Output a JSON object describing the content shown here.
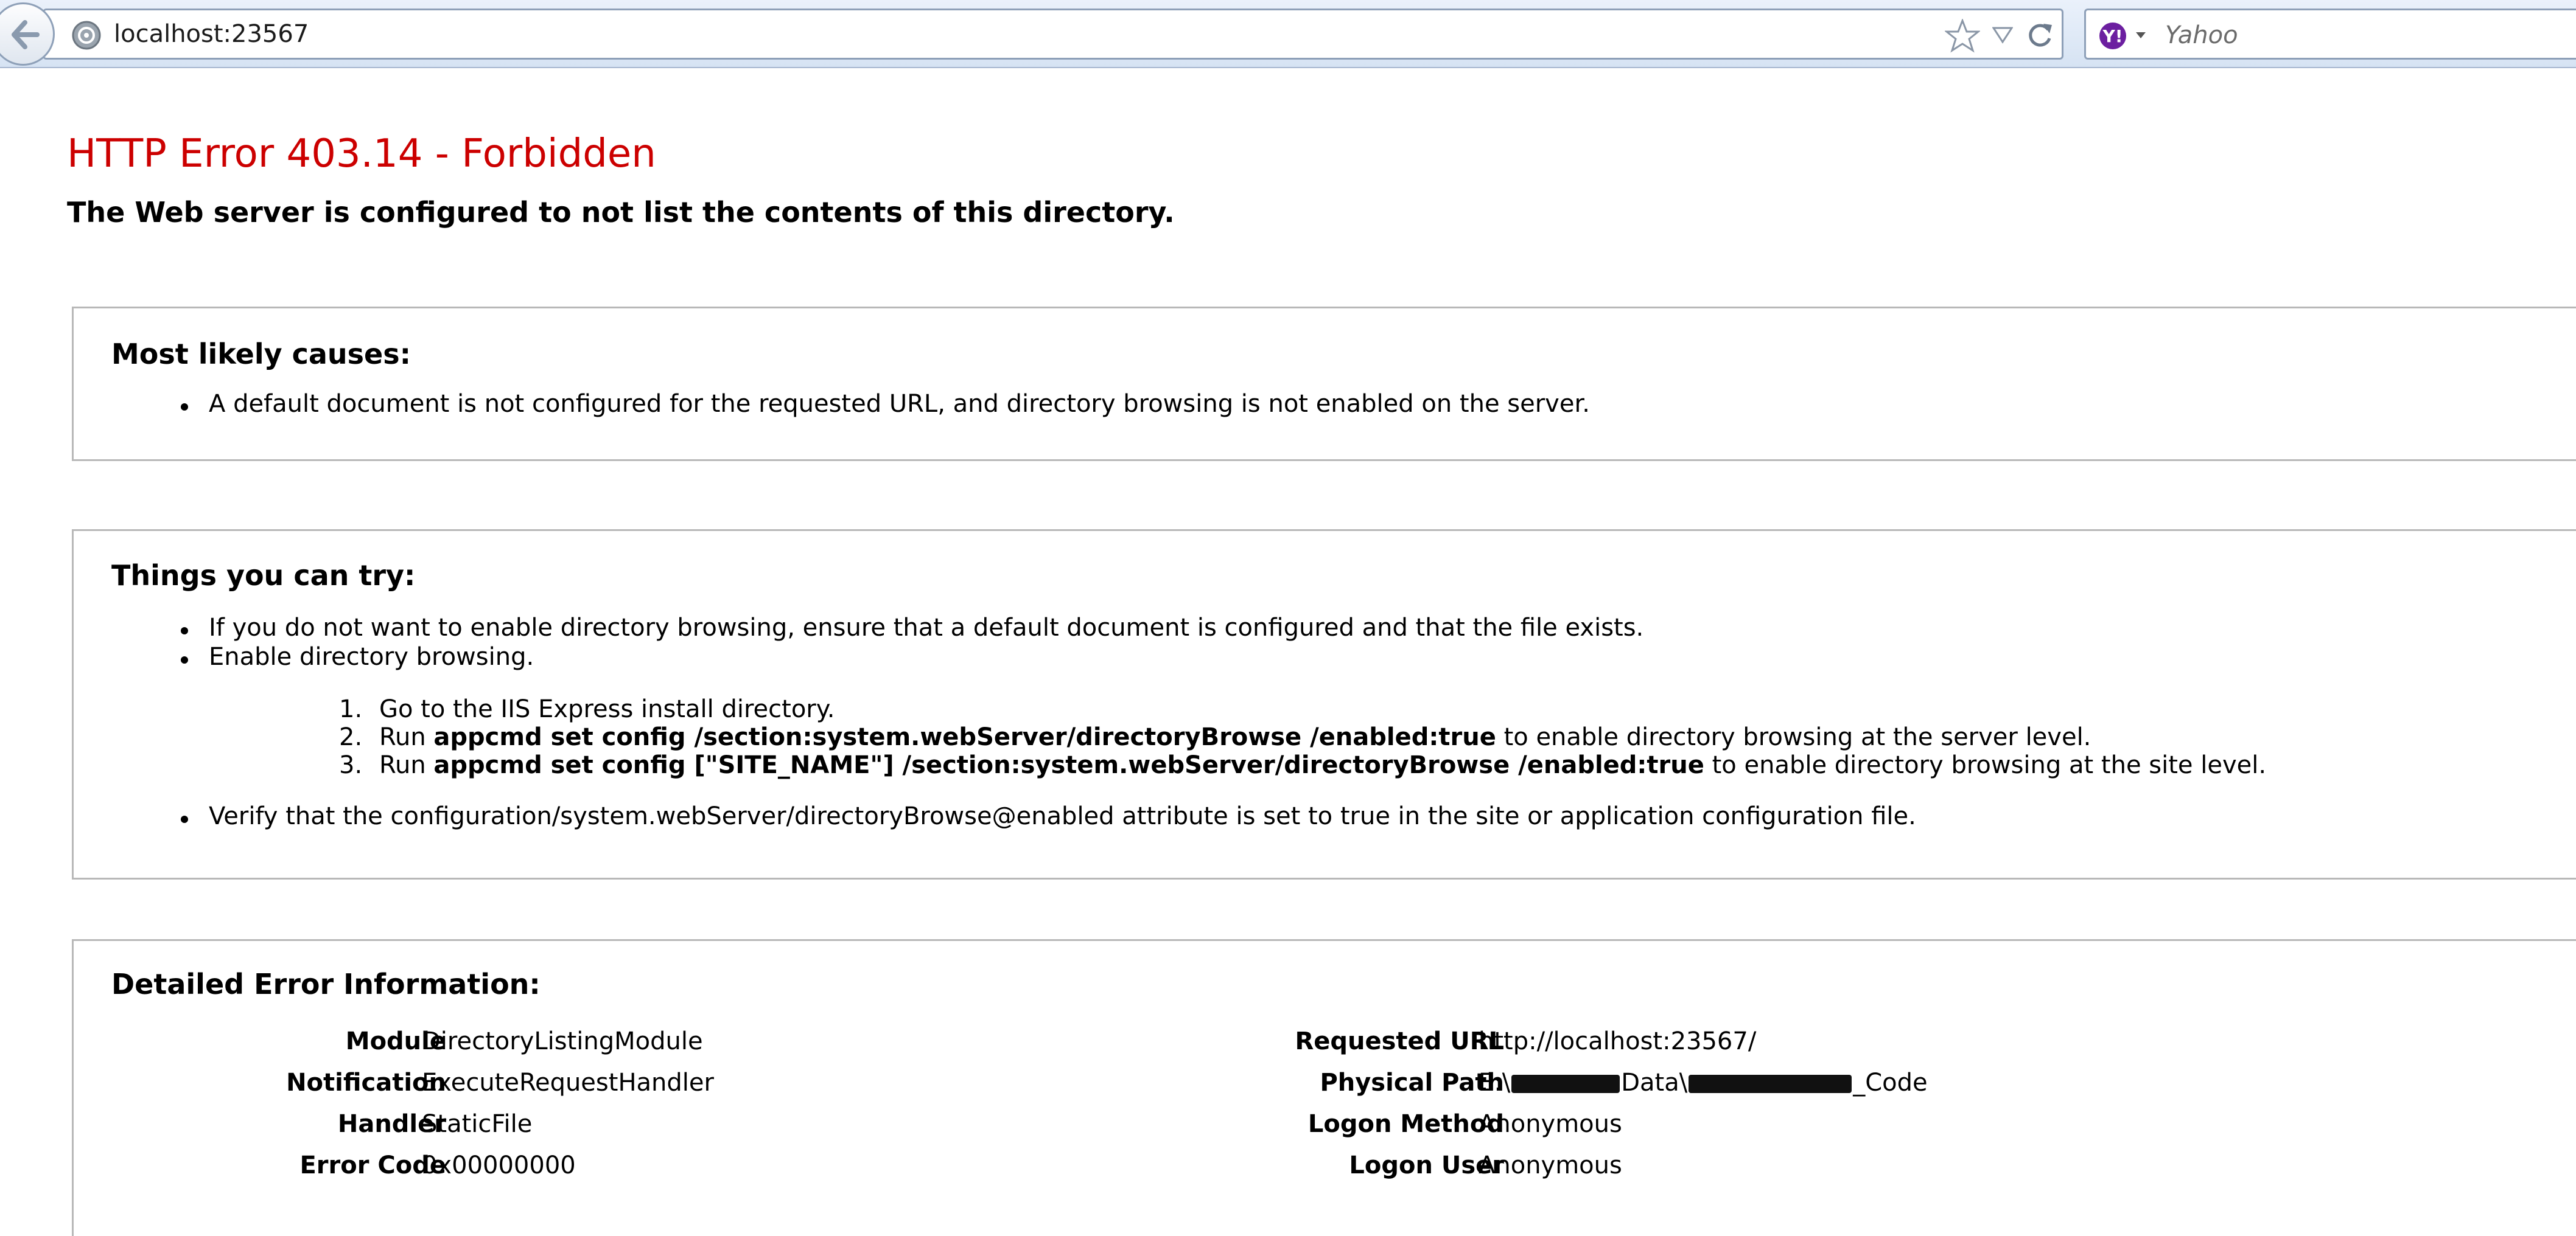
{
  "browser": {
    "url": "localhost:23567",
    "search_engine": "Yahoo",
    "search_placeholder": "Yahoo"
  },
  "page": {
    "title": "HTTP Error 403.14 - Forbidden",
    "subtitle": "The Web server is configured to not list the contents of this directory.",
    "causes": {
      "heading": "Most likely causes:",
      "items": [
        "A default document is not configured for the requested URL, and directory browsing is not enabled on the server."
      ]
    },
    "try": {
      "heading": "Things you can try:",
      "bullet1": "If you do not want to enable directory browsing, ensure that a default document is configured and that the file exists.",
      "bullet2": "Enable directory browsing.",
      "steps": [
        {
          "num": "1.",
          "pre": "Go to the IIS Express install directory.",
          "cmd": "",
          "post": ""
        },
        {
          "num": "2.",
          "pre": "Run ",
          "cmd": "appcmd set config /section:system.webServer/directoryBrowse /enabled:true",
          "post": " to enable directory browsing at the server level."
        },
        {
          "num": "3.",
          "pre": "Run ",
          "cmd": "appcmd set config [\"SITE_NAME\"] /section:system.webServer/directoryBrowse /enabled:true",
          "post": " to enable directory browsing at the site level."
        }
      ],
      "bullet3": "Verify that the configuration/system.webServer/directoryBrowse@enabled attribute is set to true in the site or application configuration file."
    },
    "details": {
      "heading": "Detailed Error Information:",
      "left": [
        {
          "label": "Module",
          "value": "DirectoryListingModule"
        },
        {
          "label": "Notification",
          "value": "ExecuteRequestHandler"
        },
        {
          "label": "Handler",
          "value": "StaticFile"
        },
        {
          "label": "Error Code",
          "value": "0x00000000"
        }
      ],
      "right": [
        {
          "label": "Requested URL",
          "value": "http://localhost:23567/"
        },
        {
          "label": "Physical Path",
          "value_prefix": "E:\\",
          "value_mid": "Data\\",
          "value_suffix": "_Code"
        },
        {
          "label": "Logon Method",
          "value": "Anonymous"
        },
        {
          "label": "Logon User",
          "value": "Anonymous"
        }
      ]
    }
  },
  "colors": {
    "title_red": "#cc0000",
    "panel_border": "#b8b8b8",
    "toolbar_bg": "#dce7f5"
  }
}
